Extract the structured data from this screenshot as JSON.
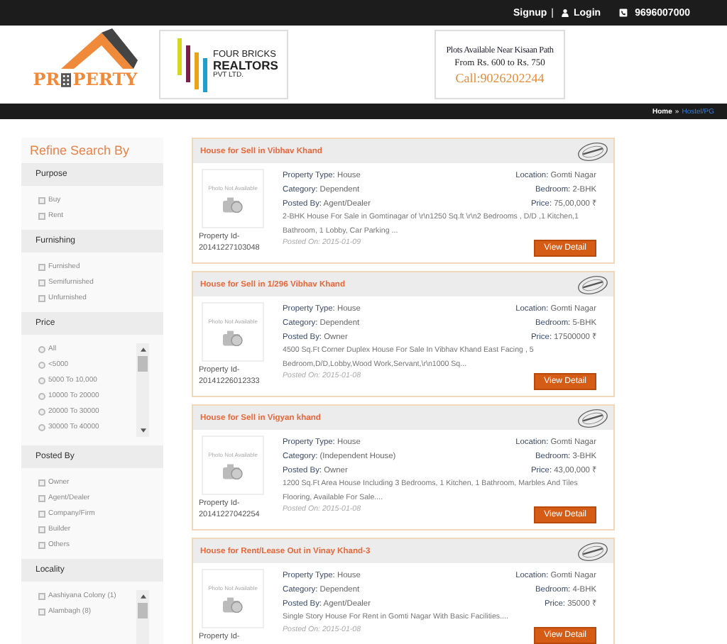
{
  "top_bar": {
    "signup": "Signup",
    "separator": "|",
    "login": "Login",
    "phone": "9696007000"
  },
  "header": {
    "logo_parts": [
      "PR",
      "PERTY"
    ],
    "ad_realtor": [
      "FOUR BRICKS",
      "REALTORS",
      "PVT LTD."
    ],
    "ad_plots": [
      "Plots Available Near Kisaan Path",
      "From Rs. 600 to Rs. 750",
      "Call:9026202244"
    ]
  },
  "breadcrumb": {
    "home": "Home",
    "separator": "»",
    "current": "Hostel/PG"
  },
  "sidebar": {
    "title": "Refine Search By",
    "sections": [
      {
        "title": "Purpose",
        "kind": "checkbox",
        "scroll": false,
        "options": [
          {
            "label": "Buy",
            "checked": false
          },
          {
            "label": "Rent",
            "checked": false
          }
        ]
      },
      {
        "title": "Furnishing",
        "kind": "checkbox",
        "scroll": false,
        "options": [
          {
            "label": "Furnished",
            "checked": false
          },
          {
            "label": "Semifurnished",
            "checked": false
          },
          {
            "label": "Unfurnished",
            "checked": false
          }
        ]
      },
      {
        "title": "Price",
        "kind": "radio",
        "scroll": true,
        "options": [
          {
            "label": "All",
            "checked": false
          },
          {
            "label": "<5000",
            "checked": false
          },
          {
            "label": "5000 To 10,000",
            "checked": false
          },
          {
            "label": "10000 To 20000",
            "checked": false
          },
          {
            "label": "20000 To 30000",
            "checked": false
          },
          {
            "label": "30000 To 40000",
            "checked": false
          }
        ]
      },
      {
        "title": "Posted By",
        "kind": "checkbox",
        "scroll": false,
        "options": [
          {
            "label": "Owner",
            "checked": false
          },
          {
            "label": "Agent/Dealer",
            "checked": false
          },
          {
            "label": "Company/Firm",
            "checked": false
          },
          {
            "label": "Builder",
            "checked": false
          },
          {
            "label": "Others",
            "checked": false
          }
        ]
      },
      {
        "title": "Locality",
        "kind": "checkbox",
        "scroll": true,
        "options": [
          {
            "label": "Aashiyana Colony (1)",
            "checked": false
          },
          {
            "label": "Alambagh (8)",
            "checked": false
          }
        ]
      }
    ]
  },
  "listings": [
    {
      "title": "House for Sell in Vibhav Khand",
      "photo_note": "Photo Not Available",
      "property_id_label": "Property Id-",
      "property_id": "20141227103048",
      "type_label": "Property Type:",
      "type": "House",
      "category_label": "Category:",
      "category": "Dependent",
      "posted_by_label": "Posted By:",
      "posted_by": "Agent/Dealer",
      "location_label": "Location:",
      "location": "Gomti Nagar",
      "bedroom_label": "Bedroom:",
      "bedroom": "2-BHK",
      "price_label": "Price:",
      "price": "75,00,000 ₹",
      "description": "2-BHK House For Sale in Gomtinagar of \\r\\n1250 Sq.ft \\r\\n2 Bedrooms , D/D ,1 Kitchen,1 Bathroom, 1 Lobby, Car Parking ...",
      "posted_on": "Posted On: 2015-01-09",
      "button": "View Detail"
    },
    {
      "title": "House for Sell in 1/296 Vibhav Khand",
      "photo_note": "Photo Not Available",
      "property_id_label": "Property Id-",
      "property_id": "20141226012333",
      "type_label": "Property Type:",
      "type": "House",
      "category_label": "Category:",
      "category": "Dependent",
      "posted_by_label": "Posted By:",
      "posted_by": "Owner",
      "location_label": "Location:",
      "location": "Gomti Nagar",
      "bedroom_label": "Bedroom:",
      "bedroom": "5-BHK",
      "price_label": "Price:",
      "price": "17500000 ₹",
      "description": "4500 Sq.Ft Corner Duplex House For Sale In Vibhav Khand East Facing , 5 Bedroom,D/D,Lobby,Wood Work,Servant,\\r\\n1000 Sq...",
      "posted_on": "Posted On: 2015-01-08",
      "button": "View Detail"
    },
    {
      "title": "House for Sell in Vigyan khand",
      "photo_note": "Photo Not Available",
      "property_id_label": "Property Id-",
      "property_id": "20141227042254",
      "type_label": "Property Type:",
      "type": "House",
      "category_label": "Category:",
      "category": "(Independent House)",
      "posted_by_label": "Posted By:",
      "posted_by": "Owner",
      "location_label": "Location:",
      "location": "Gomti Nagar",
      "bedroom_label": "Bedroom:",
      "bedroom": "3-BHK",
      "price_label": "Price:",
      "price": "43,00,000 ₹",
      "description": "1200 Sq.Ft Area House Including 3 Bedrooms, 1 Kitchen, 1 Bathroom, Marbles And Tiles Flooring, Available For Sale....",
      "posted_on": "Posted On: 2015-01-08",
      "button": "View Detail"
    },
    {
      "title": "House for Rent/Lease Out in Vinay Khand-3",
      "photo_note": "Photo Not Available",
      "property_id_label": "Property Id-",
      "type_label": "Property Type:",
      "type": "House",
      "category_label": "Category:",
      "category": "Dependent",
      "posted_by_label": "Posted By:",
      "posted_by": "Agent/Dealer",
      "location_label": "Location:",
      "location": "Gomti Nagar",
      "bedroom_label": "Bedroom:",
      "bedroom": "4-BHK",
      "price_label": "Price:",
      "price": "35000 ₹",
      "description": "Single Story House For Rent in Gomti Nagar With Basic Facilities....",
      "posted_on": "Posted On: 2015-01-08",
      "button": "View Detail"
    }
  ]
}
